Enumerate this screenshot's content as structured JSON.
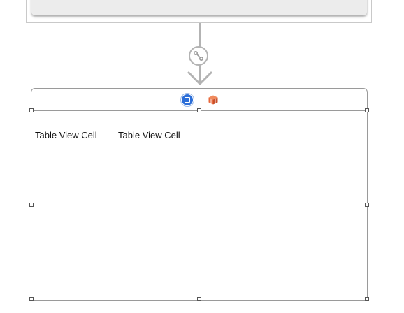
{
  "canvas": {
    "upper_scene": {},
    "segue": {
      "icon": "segue-link-icon"
    },
    "scene": {
      "dock": {
        "view_controller_icon": "view-controller-icon",
        "first_responder_icon": "cube-icon"
      },
      "table_view": {
        "cells": [
          {
            "label": "Table View Cell"
          },
          {
            "label": "Table View Cell"
          }
        ]
      }
    }
  },
  "colors": {
    "selection_blue": "#2d6fd8",
    "cube_orange": "#e8673a",
    "segue_gray": "#b3b3b3"
  }
}
